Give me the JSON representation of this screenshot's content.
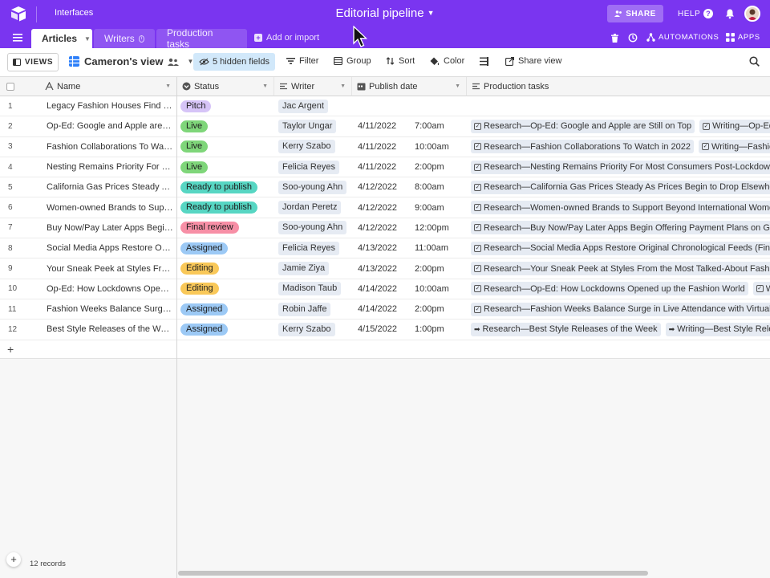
{
  "app": {
    "interfaces_label": "Interfaces",
    "base_title": "Editorial pipeline",
    "share_label": "SHARE",
    "help_label": "HELP",
    "brand_color": "#7a35f0"
  },
  "tabs": [
    {
      "label": "Articles"
    },
    {
      "label": "Writers"
    },
    {
      "label": "Production tasks"
    }
  ],
  "add_import_label": "Add or import",
  "top_tools": {
    "automations_label": "AUTOMATIONS",
    "apps_label": "APPS"
  },
  "toolbar": {
    "views_label": "VIEWS",
    "view_name": "Cameron's view",
    "hidden_fields": "5 hidden fields",
    "filter": "Filter",
    "group": "Group",
    "sort": "Sort",
    "color": "Color",
    "share_view": "Share view"
  },
  "columns": {
    "name": "Name",
    "status": "Status",
    "writer": "Writer",
    "publish_date": "Publish date",
    "production_tasks": "Production tasks"
  },
  "status_colors": {
    "Pitch": "#d6c4f7",
    "Live": "#7fd67a",
    "Ready to publish": "#57d6c3",
    "Final review": "#f78fa6",
    "Assigned": "#9cc9f5",
    "Editing": "#f9c859"
  },
  "rows": [
    {
      "num": "1",
      "name": "Legacy Fashion Houses Find N...",
      "status": "Pitch",
      "writer": "Jac Argent",
      "date": "",
      "time": "",
      "tasks": []
    },
    {
      "num": "2",
      "name": "Op-Ed: Google and Apple are S...",
      "status": "Live",
      "writer": "Taylor Ungar",
      "date": "4/11/2022",
      "time": "7:00am",
      "tasks": [
        {
          "icon": "check",
          "text": "Research—Op-Ed: Google and Apple are Still on Top"
        },
        {
          "icon": "check",
          "text": "Writing—Op-Ed: G"
        }
      ]
    },
    {
      "num": "3",
      "name": "Fashion Collaborations To Wat...",
      "status": "Live",
      "writer": "Kerry Szabo",
      "date": "4/11/2022",
      "time": "10:00am",
      "tasks": [
        {
          "icon": "check",
          "text": "Research—Fashion Collaborations To Watch in 2022"
        },
        {
          "icon": "check",
          "text": "Writing—Fashion C"
        }
      ]
    },
    {
      "num": "4",
      "name": "Nesting Remains Priority For M...",
      "status": "Live",
      "writer": "Felicia Reyes",
      "date": "4/11/2022",
      "time": "2:00pm",
      "tasks": [
        {
          "icon": "check",
          "text": "Research—Nesting Remains Priority For Most Consumers Post-Lockdown"
        }
      ]
    },
    {
      "num": "5",
      "name": "California Gas Prices Steady A...",
      "status": "Ready to publish",
      "writer": "Soo-young Ahn",
      "date": "4/12/2022",
      "time": "8:00am",
      "tasks": [
        {
          "icon": "check",
          "text": "Research—California Gas Prices Steady As Prices Begin to Drop Elsewhere"
        }
      ]
    },
    {
      "num": "6",
      "name": "Women-owned Brands to Supp...",
      "status": "Ready to publish",
      "writer": "Jordan Peretz",
      "date": "4/12/2022",
      "time": "9:00am",
      "tasks": [
        {
          "icon": "check",
          "text": "Research—Women-owned Brands to Support Beyond International Women's"
        }
      ]
    },
    {
      "num": "7",
      "name": "Buy Now/Pay Later Apps Begin...",
      "status": "Final review",
      "writer": "Soo-young Ahn",
      "date": "4/12/2022",
      "time": "12:00pm",
      "tasks": [
        {
          "icon": "check",
          "text": "Research—Buy Now/Pay Later Apps Begin Offering Payment Plans on Gas a"
        }
      ]
    },
    {
      "num": "8",
      "name": "Social Media Apps Restore Ori...",
      "status": "Assigned",
      "writer": "Felicia Reyes",
      "date": "4/13/2022",
      "time": "11:00am",
      "tasks": [
        {
          "icon": "check",
          "text": "Research—Social Media Apps Restore Original Chronological Feeds (Finally"
        }
      ]
    },
    {
      "num": "9",
      "name": "Your Sneak Peek at Styles Fro...",
      "status": "Editing",
      "writer": "Jamie Ziya",
      "date": "4/13/2022",
      "time": "2:00pm",
      "tasks": [
        {
          "icon": "check",
          "text": "Research—Your Sneak Peek at Styles From the Most Talked-About Fashion"
        }
      ]
    },
    {
      "num": "10",
      "name": "Op-Ed: How Lockdowns Opene...",
      "status": "Editing",
      "writer": "Madison Taub",
      "date": "4/14/2022",
      "time": "10:00am",
      "tasks": [
        {
          "icon": "check",
          "text": "Research—Op-Ed: How Lockdowns Opened up the Fashion World"
        },
        {
          "icon": "check",
          "text": "Writin"
        }
      ]
    },
    {
      "num": "11",
      "name": "Fashion Weeks Balance Surge i...",
      "status": "Assigned",
      "writer": "Robin Jaffe",
      "date": "4/14/2022",
      "time": "2:00pm",
      "tasks": [
        {
          "icon": "check",
          "text": "Research—Fashion Weeks Balance Surge in Live Attendance with Virtual Au"
        }
      ]
    },
    {
      "num": "12",
      "name": "Best Style Releases of the Week",
      "status": "Assigned",
      "writer": "Kerry Szabo",
      "date": "4/15/2022",
      "time": "1:00pm",
      "tasks": [
        {
          "icon": "arrow",
          "text": "Research—Best Style Releases of the Week"
        },
        {
          "icon": "arrow",
          "text": "Writing—Best Style Release"
        }
      ]
    }
  ],
  "footer": {
    "records": "12 records"
  }
}
